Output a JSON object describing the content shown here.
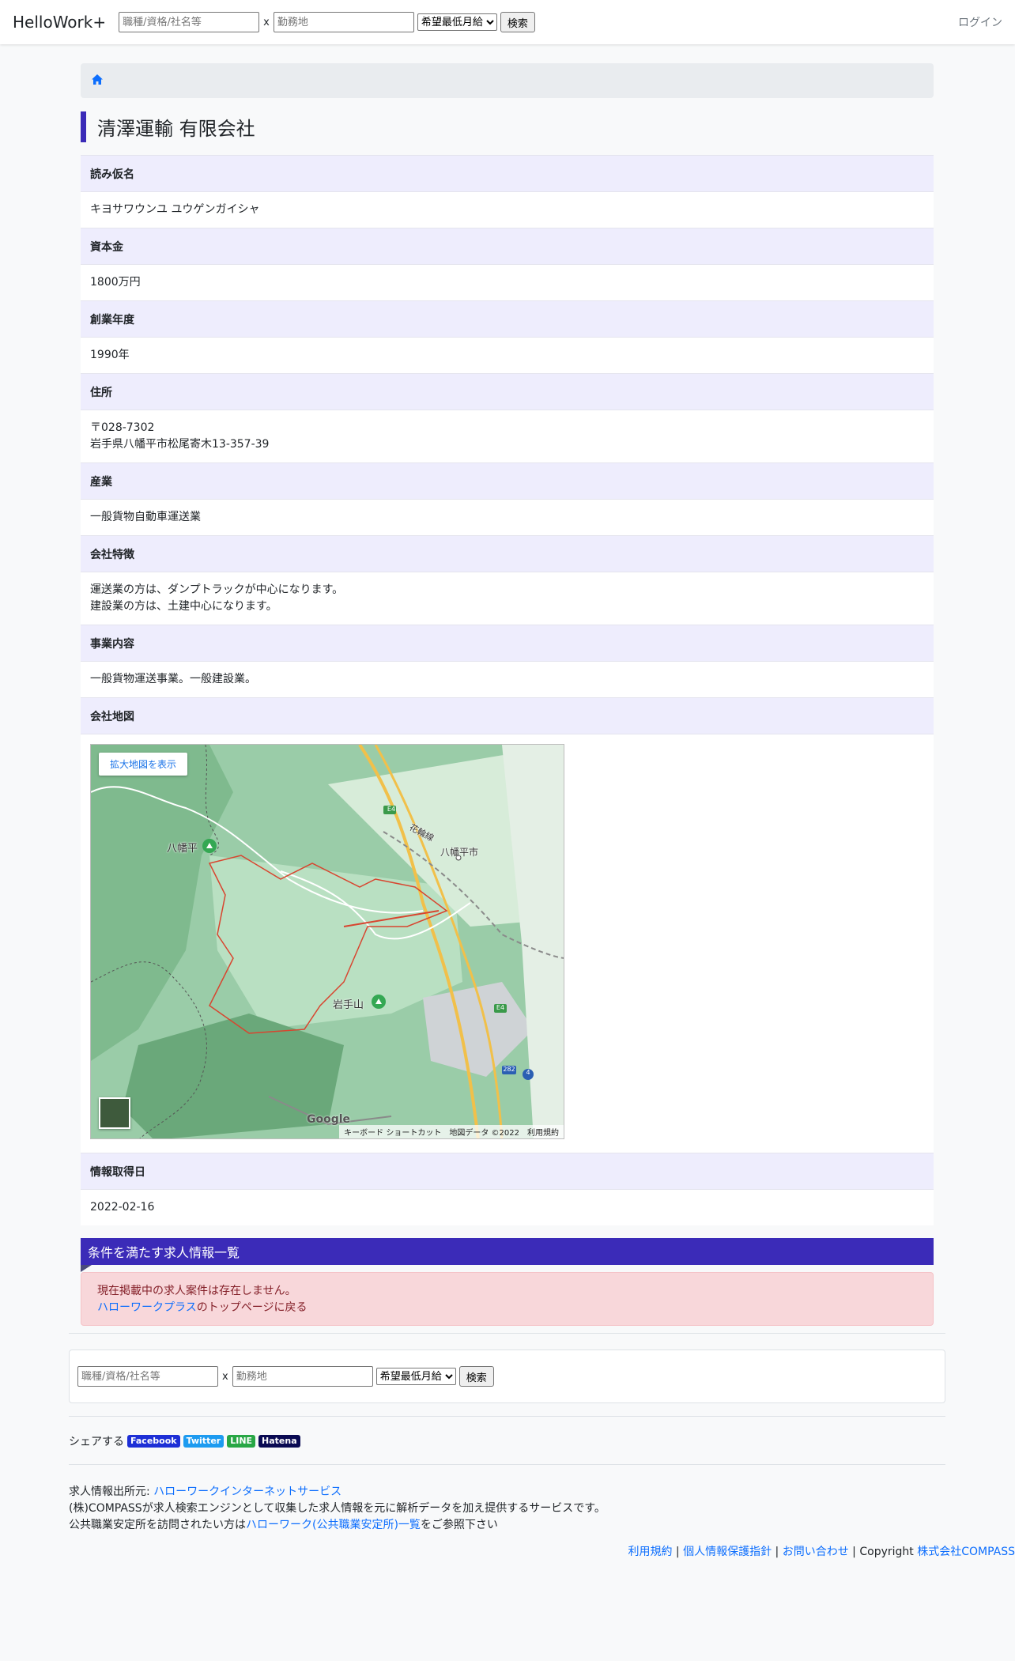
{
  "nav": {
    "brand": "HelloWork+",
    "job_placeholder": "職種/資格/社名等",
    "sep": "x",
    "location_placeholder": "勤務地",
    "salary_select": "希望最低月給",
    "search_label": "検索",
    "login_label": "ログイン"
  },
  "company": {
    "name": "清澤運輸 有限会社",
    "fields": {
      "kana_label": "読み仮名",
      "kana_value": "キヨサワウンユ ユウゲンガイシャ",
      "capital_label": "資本金",
      "capital_value": "1800万円",
      "founded_label": "創業年度",
      "founded_value": "1990年",
      "address_label": "住所",
      "address_postal": "〒028-7302",
      "address_line": "岩手県八幡平市松尾寄木13-357-39",
      "industry_label": "産業",
      "industry_value": "一般貨物自動車運送業",
      "features_label": "会社特徴",
      "features_line1": "運送業の方は、ダンプトラックが中心になります。",
      "features_line2": "建設業の方は、土建中心になります。",
      "business_label": "事業内容",
      "business_value": "一般貨物運送事業。一般建設業。",
      "map_label": "会社地図",
      "retrieved_label": "情報取得日",
      "retrieved_value": "2022-02-16"
    }
  },
  "map": {
    "enlarge_label": "拡大地図を表示",
    "label_hachimantai": "八幡平",
    "label_city": "八幡平市",
    "label_iwate": "岩手山",
    "label_hanawa": "花輪線",
    "road_e4": "E4",
    "road_282": "282",
    "road_4": "4",
    "google": "Google",
    "footer_shortcuts": "キーボード ショートカット",
    "footer_data": "地図データ ©2022",
    "footer_terms": "利用規約"
  },
  "jobs": {
    "heading": "条件を満たす求人情報一覧",
    "empty_msg": "現在掲載中の求人案件は存在しません。",
    "link": "ハローワークプラス",
    "link_suffix": "のトップページに戻る"
  },
  "footer": {
    "job_placeholder": "職種/資格/社名等",
    "sep": "x",
    "location_placeholder": "勤務地",
    "salary_select": "希望最低月給",
    "search_label": "検索",
    "share_label": "シェアする",
    "share_facebook": "Facebook",
    "share_twitter": "Twitter",
    "share_line": "LINE",
    "share_hatena": "Hatena",
    "source_prefix": "求人情報出所元: ",
    "source_link": "ハローワークインターネットサービス",
    "about_line": "(株)COMPASSが求人検索エンジンとして収集した求人情報を元に解析データを加え提供するサービスです。",
    "visit_prefix": "公共職業安定所を訪問されたい方は",
    "visit_link": "ハローワーク(公共職業安定所)一覧",
    "visit_suffix": "をご参照下さい",
    "terms": "利用規約",
    "privacy": "個人情報保護指針",
    "contact": "お問い合わせ",
    "divider": " | ",
    "copyright_prefix": "Copyright ",
    "company_link": "株式会社COMPASS"
  },
  "colors": {
    "accent": "#3b2bb8",
    "label_bg": "#eeedfd",
    "alert_bg": "#f8d7da",
    "facebook": "#1d2fd6",
    "twitter": "#1d9bf0",
    "line": "#28a745",
    "hatena": "#0a0a52"
  }
}
